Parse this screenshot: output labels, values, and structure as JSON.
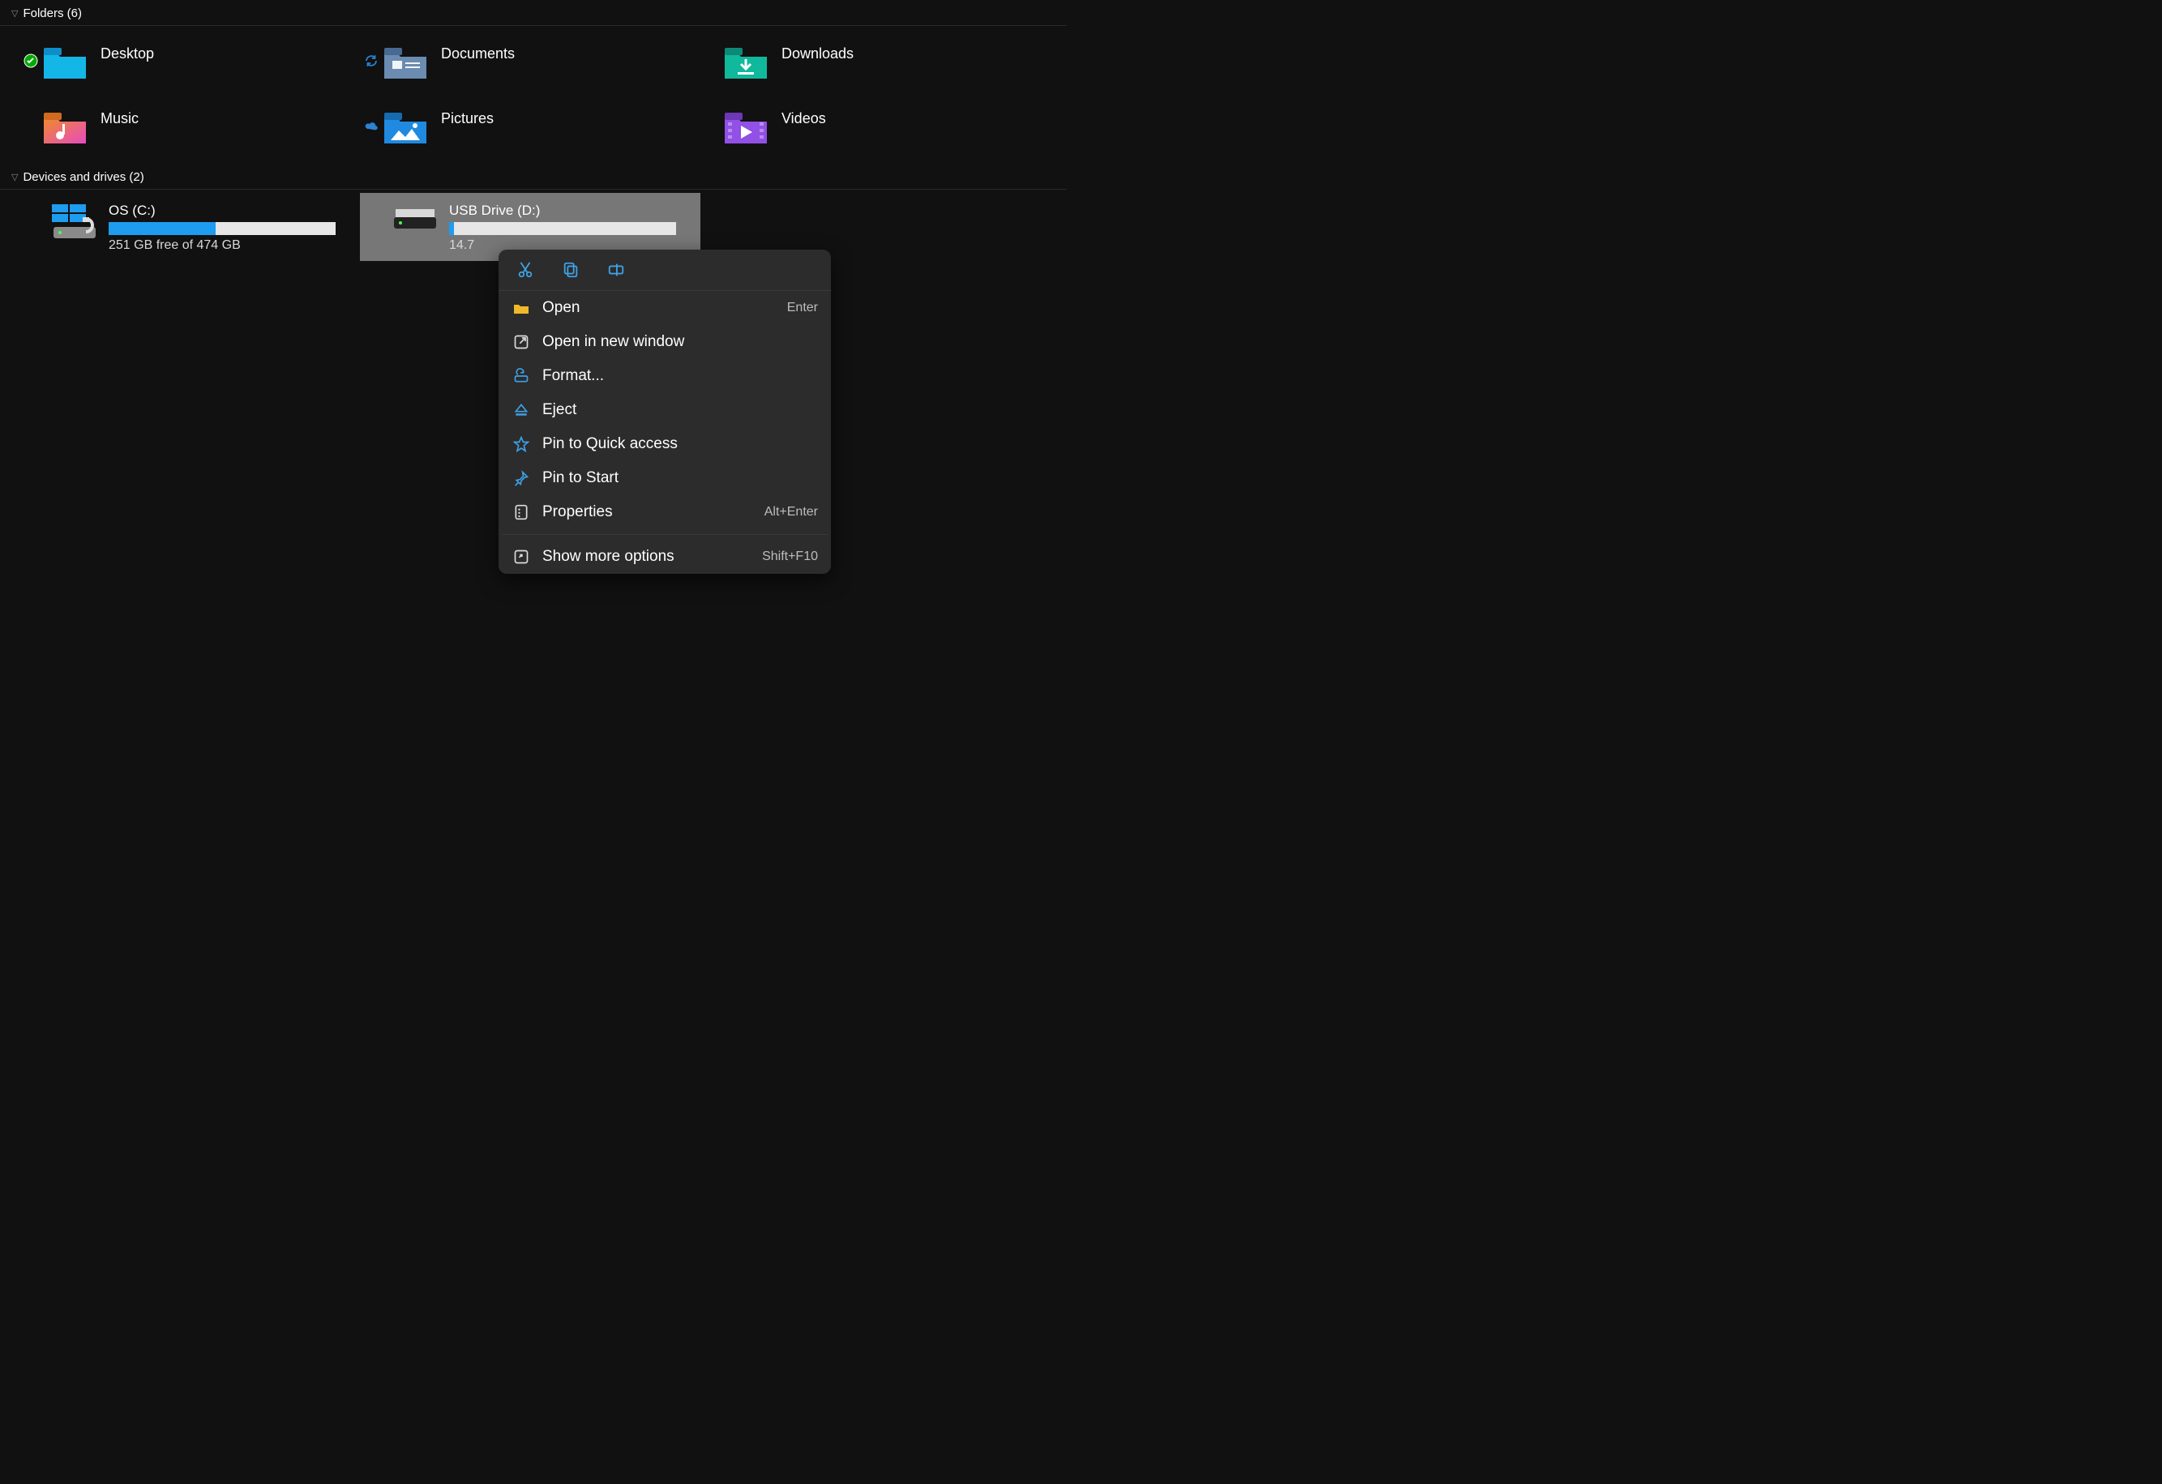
{
  "sections": {
    "folders": {
      "title": "Folders",
      "count": 6
    },
    "drives": {
      "title": "Devices and drives",
      "count": 2
    }
  },
  "folders": [
    {
      "label": "Desktop",
      "status": "synced"
    },
    {
      "label": "Documents",
      "status": "syncing"
    },
    {
      "label": "Downloads",
      "status": null
    },
    {
      "label": "Music",
      "status": null
    },
    {
      "label": "Pictures",
      "status": "cloud"
    },
    {
      "label": "Videos",
      "status": null
    }
  ],
  "drives": [
    {
      "name": "OS (C:)",
      "free_text": "251 GB free of 474 GB",
      "fill_percent": 47,
      "selected": false
    },
    {
      "name": "USB Drive (D:)",
      "free_text": "14.7",
      "fill_percent": 1,
      "selected": true
    }
  ],
  "context_menu": {
    "items": [
      {
        "icon": "open",
        "label": "Open",
        "accel": "Enter"
      },
      {
        "icon": "new-window",
        "label": "Open in new window",
        "accel": ""
      },
      {
        "icon": "format",
        "label": "Format...",
        "accel": ""
      },
      {
        "icon": "eject",
        "label": "Eject",
        "accel": ""
      },
      {
        "icon": "star",
        "label": "Pin to Quick access",
        "accel": ""
      },
      {
        "icon": "pin",
        "label": "Pin to Start",
        "accel": ""
      },
      {
        "icon": "properties",
        "label": "Properties",
        "accel": "Alt+Enter"
      }
    ],
    "more": {
      "label": "Show more options",
      "accel": "Shift+F10"
    }
  }
}
